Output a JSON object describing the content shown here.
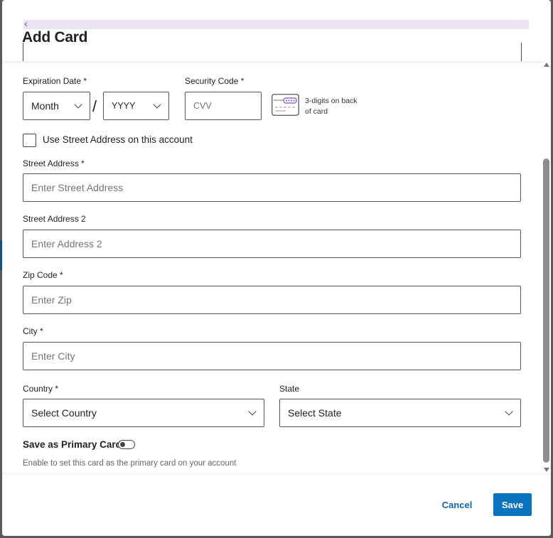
{
  "dialog": {
    "title": "Add Card",
    "back_icon": "chevron-left-icon"
  },
  "expiration": {
    "label": "Expiration Date *",
    "month_value": "Month",
    "year_value": "YYYY",
    "separator": "/"
  },
  "security": {
    "label": "Security Code *",
    "placeholder": "CVV",
    "hint": "3-digits on back of card",
    "icon": "card-back-icon"
  },
  "use_street": {
    "label": "Use Street Address on this account",
    "checked": false
  },
  "street": {
    "label": "Street Address *",
    "placeholder": "Enter Street Address"
  },
  "street2": {
    "label": "Street Address 2",
    "placeholder": "Enter Address 2"
  },
  "zip": {
    "label": "Zip Code *",
    "placeholder": "Enter Zip"
  },
  "city": {
    "label": "City *",
    "placeholder": "Enter City"
  },
  "country": {
    "label": "Country *",
    "value": "Select Country"
  },
  "state": {
    "label": "State",
    "value": "Select State"
  },
  "primary": {
    "label": "Save as Primary Card",
    "enabled": false,
    "description": "Enable to set this card as the primary card on your account"
  },
  "footer": {
    "cancel_label": "Cancel",
    "save_label": "Save"
  },
  "colors": {
    "accent": "#0a73c0",
    "link": "#1565a8",
    "header_tint": "#ebe3f1",
    "back_icon": "#7a4fb0"
  }
}
